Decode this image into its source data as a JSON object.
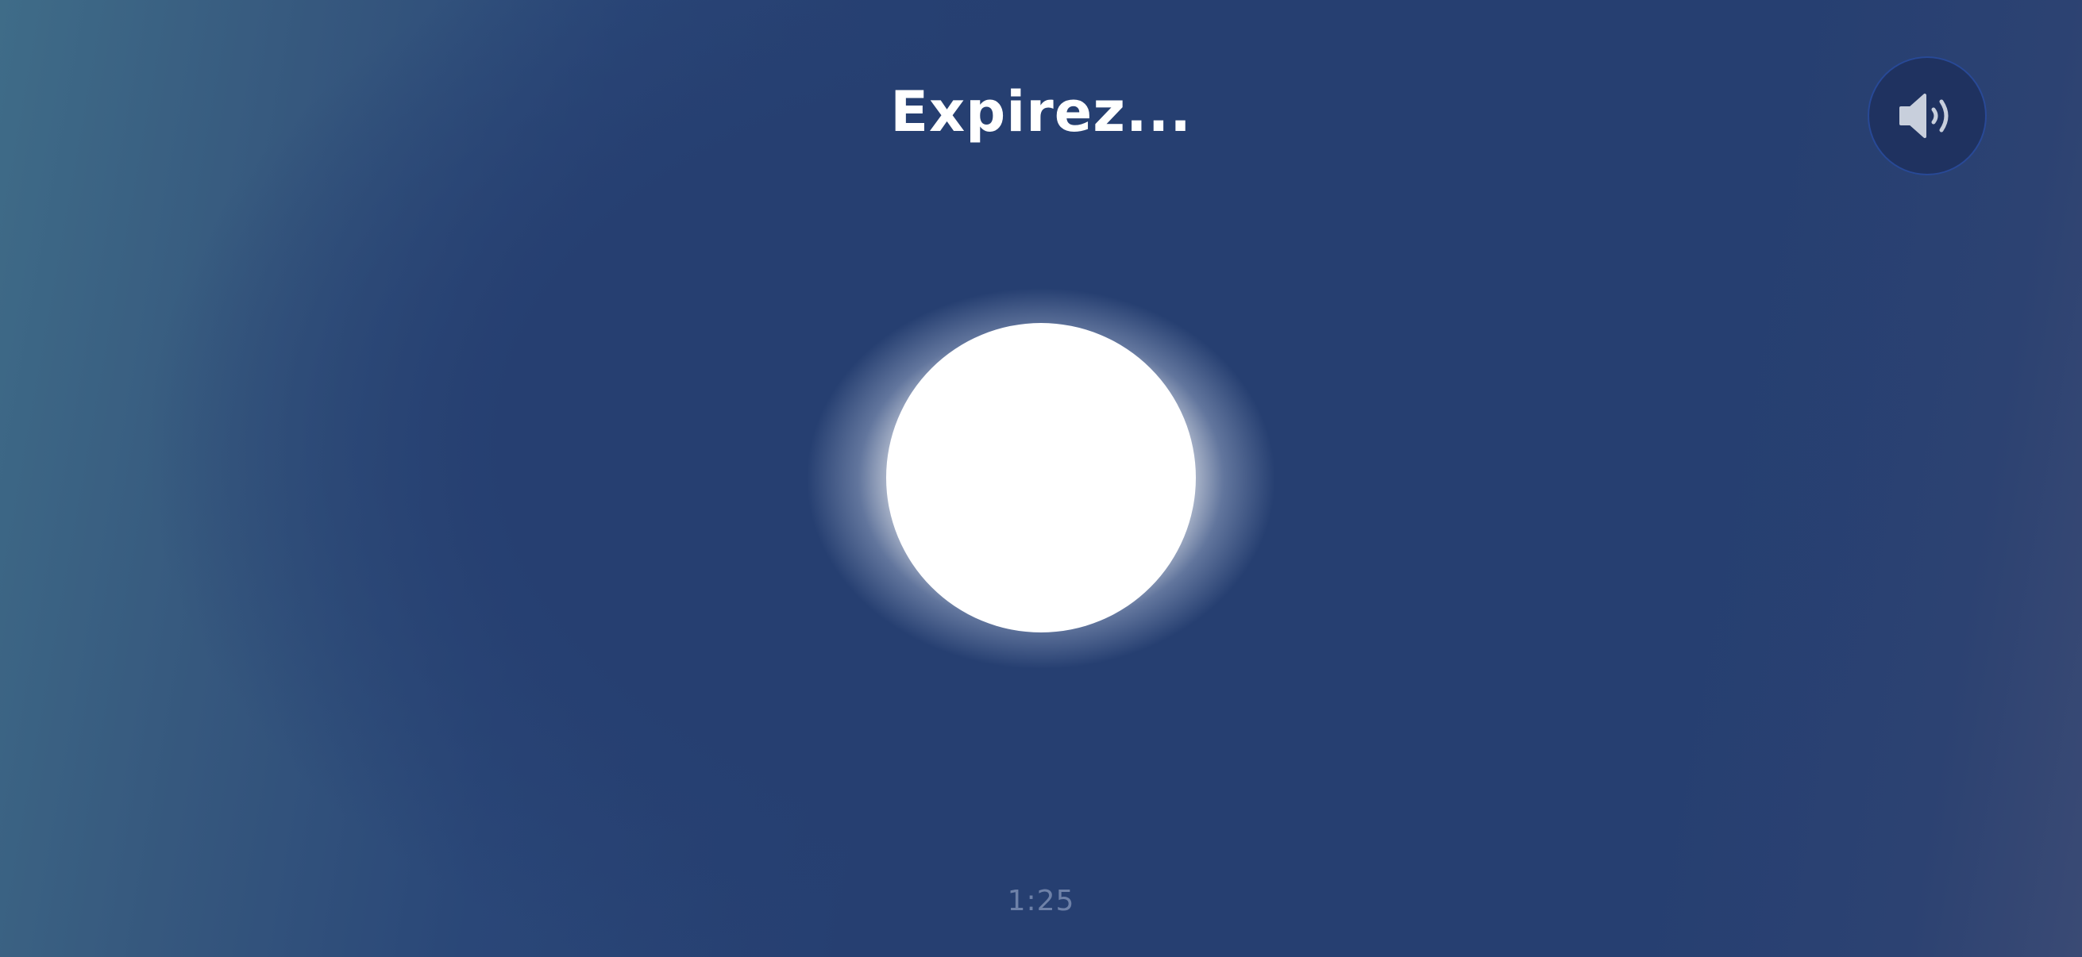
{
  "instruction": "Expirez...",
  "timer": "1:25",
  "sound_button": {
    "icon": "speaker-wave-icon"
  },
  "colors": {
    "background": "#263f71",
    "background_left": "#3f6c88",
    "circle": "#ffffff",
    "button": "#1f3260",
    "icon": "#c8cfdc"
  }
}
